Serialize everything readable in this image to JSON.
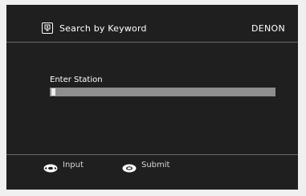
{
  "header": {
    "title": "Search by Keyword",
    "brand": "DENON",
    "icon": "search-station-icon"
  },
  "form": {
    "label": "Enter Station",
    "value": ""
  },
  "footer": {
    "items": [
      {
        "label": "Input",
        "icon": "cursor-pad-icon"
      },
      {
        "label": "Submit",
        "icon": "enter-button-icon"
      }
    ]
  },
  "colors": {
    "background": "#1f1f1f",
    "text": "#ffffff",
    "field": "#8e8e8e",
    "cursor": "#ececec",
    "divider": "#6a6a6a"
  }
}
